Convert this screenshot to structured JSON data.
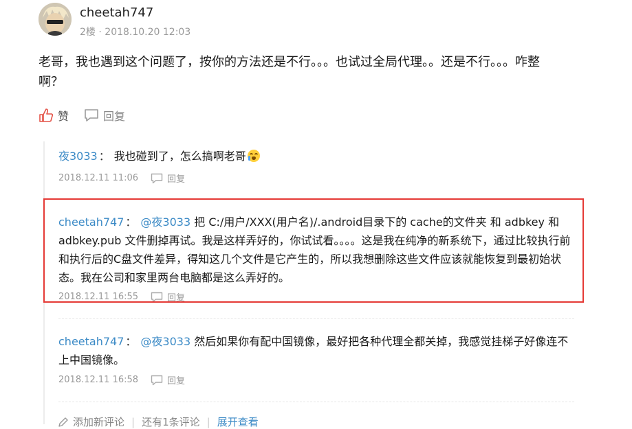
{
  "post": {
    "author": "cheetah747",
    "floor": "2楼",
    "meta_sep": " · ",
    "time": "2018.10.20 12:03",
    "text": "老哥，我也遇到这个问题了，按你的方法还是不行。。。也试过全局代理。。还是不行。。。咋整啊？",
    "like_label": "赞",
    "reply_label": "回复"
  },
  "comments": [
    {
      "user": "夜3033",
      "colon": "：",
      "mention": "",
      "text": "我也碰到了，怎么搞啊老哥",
      "emoji": "crying-face",
      "time": "2018.12.11 11:06",
      "reply_label": "回复"
    },
    {
      "user": "cheetah747",
      "colon": "：",
      "mention": "@夜3033",
      "text": " 把 C:/用户/XXX(用户名)/.android目录下的 cache的文件夹 和 adbkey 和 adbkey.pub 文件删掉再试。我是这样弄好的，你试试看。。。。这是我在纯净的新系统下，通过比较执行前和执行后的C盘文件差异，得知这几个文件是它产生的，所以我想删除这些文件应该就能恢复到最初始状态。我在公司和家里两台电脑都是这么弄好的。",
      "time": "2018.12.11 16:55",
      "reply_label": "回复"
    },
    {
      "user": "cheetah747",
      "colon": "：",
      "mention": "@夜3033",
      "text": " 然后如果你有配中国镜像，最好把各种代理全都关掉，我感觉挂梯子好像连不上中国镜像。",
      "time": "2018.12.11 16:58",
      "reply_label": "回复"
    }
  ],
  "footer": {
    "add_comment": "添加新评论",
    "remaining": "还有1条评论",
    "expand": "展开查看"
  },
  "colors": {
    "link": "#3b8ac6",
    "highlight": "#e53935",
    "like": "#e4554a"
  }
}
